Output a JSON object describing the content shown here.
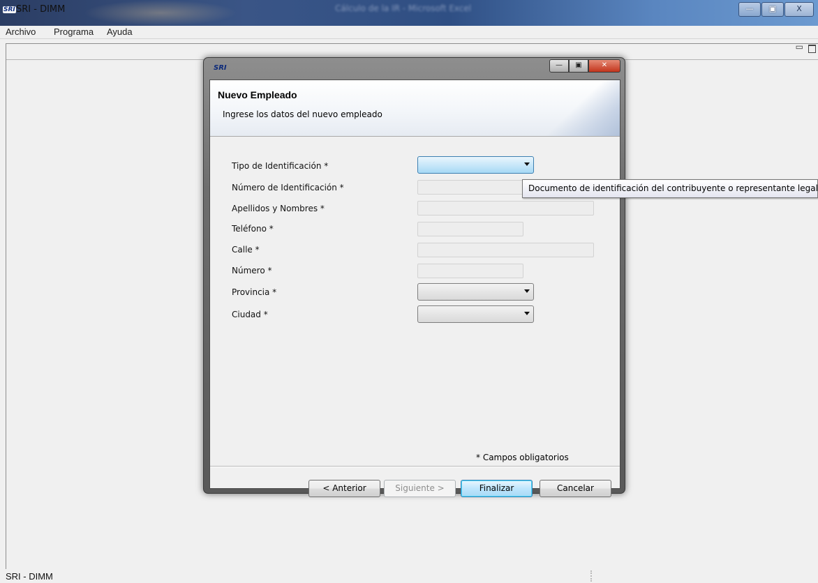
{
  "window": {
    "logo_text": "SRI",
    "title": "SRI - DIMM",
    "background_title": "Cálculo de la IR - Microsoft Excel",
    "controls": {
      "minimize": "—",
      "maximize": "▣",
      "close": "X"
    }
  },
  "menu": {
    "items": [
      "Archivo",
      "Programa",
      "Ayuda"
    ]
  },
  "desktop": {
    "minimize_glyph": "▭"
  },
  "dialog": {
    "logo_text": "SRI",
    "controls": {
      "minimize": "—",
      "maximize": "▣",
      "close": "✕"
    },
    "header": {
      "title": "Nuevo Empleado",
      "subtitle": "Ingrese los datos del nuevo empleado"
    },
    "fields": [
      {
        "label": "Tipo de Identificación *",
        "type": "combo",
        "value": ""
      },
      {
        "label": "Número de Identificación *",
        "type": "text",
        "value": ""
      },
      {
        "label": "Apellidos y Nombres *",
        "type": "text",
        "value": ""
      },
      {
        "label": "Teléfono *",
        "type": "text",
        "value": ""
      },
      {
        "label": "Calle *",
        "type": "text",
        "value": ""
      },
      {
        "label": "Número *",
        "type": "text",
        "value": ""
      },
      {
        "label": "Provincia *",
        "type": "combo",
        "value": ""
      },
      {
        "label": "Ciudad *",
        "type": "combo",
        "value": ""
      }
    ],
    "required_note": "* Campos obligatorios",
    "buttons": {
      "previous": "< Anterior",
      "next": "Siguiente >",
      "finish": "Finalizar",
      "cancel": "Cancelar"
    }
  },
  "tooltip": {
    "text": "Documento de identificación del contribuyente o representante legal"
  },
  "statusbar": {
    "text": "SRI - DIMM"
  },
  "colors": {
    "title_bar": "#3a5586",
    "focus_blue": "#3c7fb1",
    "dialog_frame": "#6e6e6e"
  }
}
